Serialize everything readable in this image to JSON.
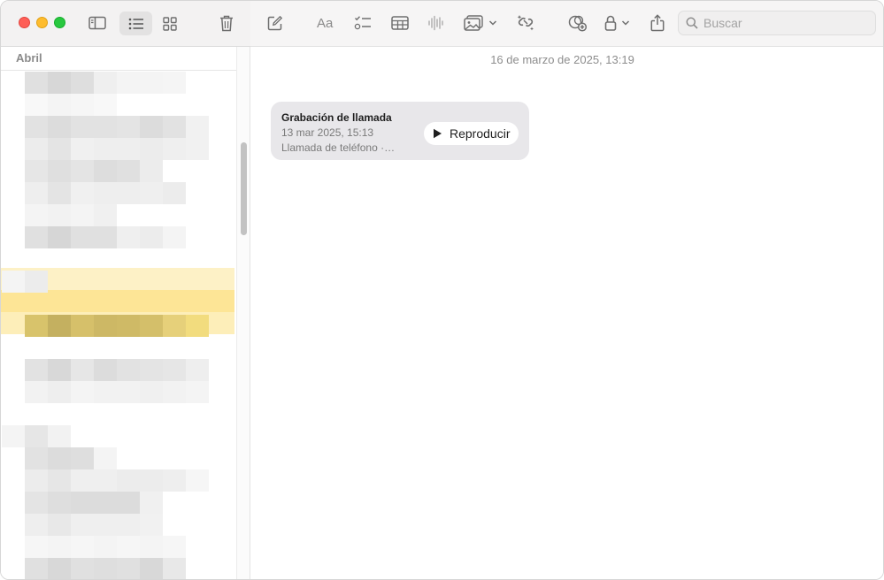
{
  "toolbar": {
    "search_placeholder": "Buscar"
  },
  "sidebar": {
    "section_header": "Abril"
  },
  "note": {
    "date": "16 de marzo de 2025, 13:19",
    "call_recording": {
      "title": "Grabación de llamada",
      "date": "13 mar 2025, 15:13",
      "subtitle": "Llamada de teléfono ·…",
      "play_label": "Reproducir"
    }
  },
  "icons": {
    "close": "window-close-button",
    "minimize": "window-minimize-button",
    "maximize": "window-maximize-button",
    "sidebar_toggle": "sidebar-icon",
    "list_view": "list-view-icon",
    "gallery_view": "gallery-view-icon",
    "delete": "trash-icon",
    "new_note": "compose-icon",
    "format": "text-format-icon",
    "checklist": "checklist-icon",
    "table": "table-icon",
    "audio": "waveform-icon",
    "media": "photo-icon",
    "link": "link-icon",
    "collaborate": "collaborate-icon",
    "lock": "lock-icon",
    "share": "share-icon",
    "search": "search-icon",
    "play": "play-icon"
  },
  "colors": {
    "close": "#fe5f57",
    "minimize": "#febc2e",
    "maximize": "#28c840",
    "highlight": "#fde596"
  }
}
